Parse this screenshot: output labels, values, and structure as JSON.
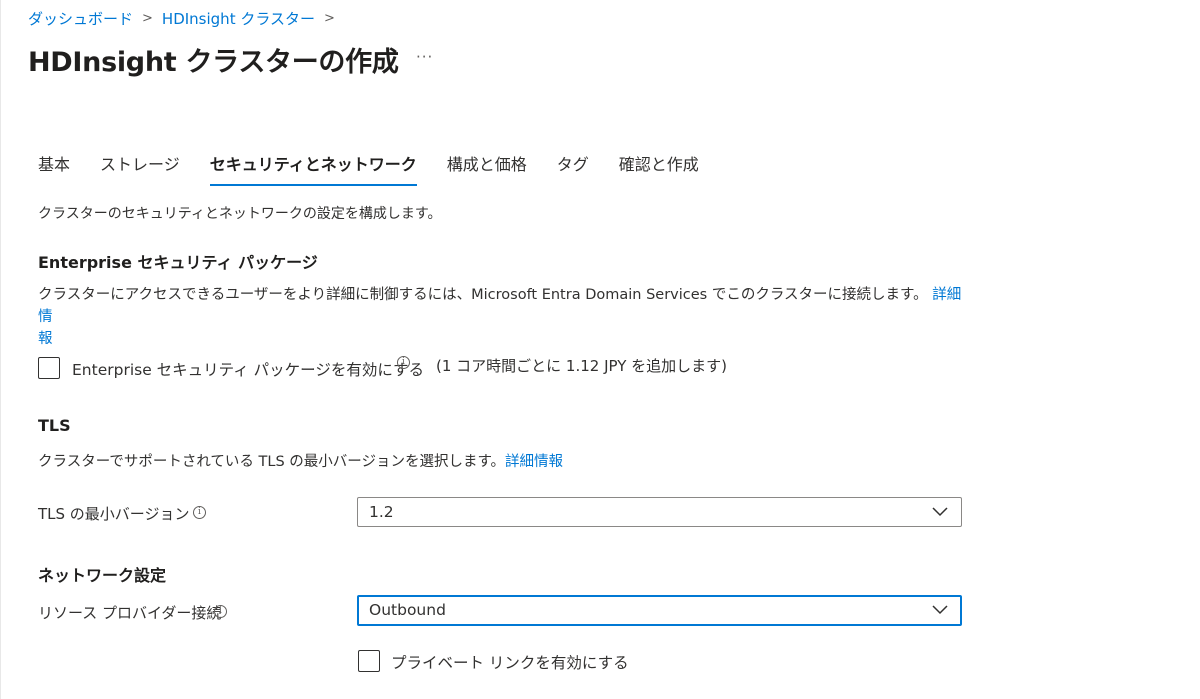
{
  "breadcrumb": {
    "items": [
      "ダッシュボード",
      "HDInsight クラスター"
    ],
    "separator": ">"
  },
  "page": {
    "title": "HDInsight クラスターの作成",
    "more": "···"
  },
  "tabs": [
    {
      "label": "基本",
      "active": false
    },
    {
      "label": "ストレージ",
      "active": false
    },
    {
      "label": "セキュリティとネットワーク",
      "active": true
    },
    {
      "label": "構成と価格",
      "active": false
    },
    {
      "label": "タグ",
      "active": false
    },
    {
      "label": "確認と作成",
      "active": false
    }
  ],
  "tab_description": "クラスターのセキュリティとネットワークの設定を構成します。",
  "esp": {
    "title": "Enterprise セキュリティ パッケージ",
    "description": "クラスターにアクセスできるユーザーをより詳細に制御するには、Microsoft Entra Domain Services でこのクラスターに接続します。",
    "link_part1": "詳細情",
    "link_part2": "報",
    "checkbox_label": "Enterprise セキュリティ パッケージを有効にする",
    "checkbox_checked": false,
    "info_glyph": "i",
    "cost_note": "(1 コア時間ごとに 1.12 JPY を追加します)"
  },
  "tls": {
    "title": "TLS",
    "description": "クラスターでサポートされている TLS の最小バージョンを選択します。",
    "link": "詳細情報",
    "field_label": "TLS の最小バージョン",
    "info_glyph": "i",
    "value": "1.2"
  },
  "network": {
    "title": "ネットワーク設定",
    "field_label": "リソース プロバイダー接続",
    "info_glyph": "i",
    "value": "Outbound",
    "private_link_label": "プライベート リンクを有効にする",
    "private_link_checked": false
  },
  "colors": {
    "accent": "#0078d4",
    "text": "#323130",
    "border": "#8a8886"
  },
  "icons": {
    "chevron": "chevron-down-icon",
    "info": "info-icon",
    "breadcrumb_sep": "chevron-right-icon"
  }
}
